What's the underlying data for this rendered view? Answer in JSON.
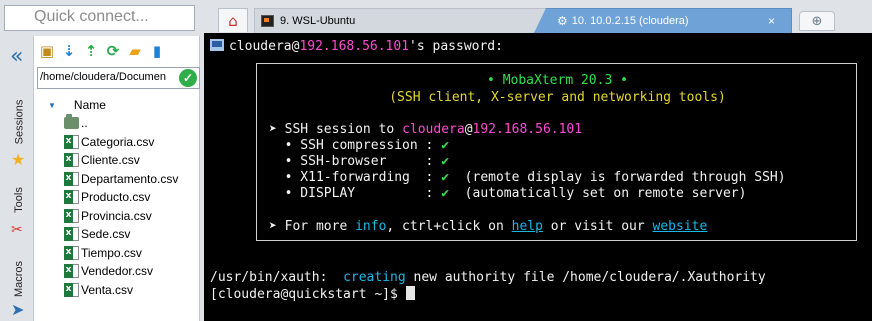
{
  "sidebar": {
    "quick_connect_placeholder": "Quick connect...",
    "collapse_glyph": "«",
    "vertical_tabs": [
      "Sessions",
      "Tools",
      "Macros"
    ],
    "path": "/home/cloudera/Documen",
    "file_header": "Name",
    "parent_dir": "..",
    "files": [
      "Categoria.csv",
      "Cliente.csv",
      "Departamento.csv",
      "Producto.csv",
      "Provincia.csv",
      "Sede.csv",
      "Tiempo.csv",
      "Vendedor.csv",
      "Venta.csv"
    ]
  },
  "tabs": {
    "tab1_label": "9. WSL-Ubuntu",
    "tab2_label": "10. 10.0.2.15 (cloudera)",
    "close_glyph": "×"
  },
  "terminal": {
    "pw_user": "cloudera",
    "pw_at": "@",
    "pw_host": "192.168.56.101",
    "pw_suffix": "'s password:",
    "banner_title": "• MobaXterm 20.3 •",
    "banner_sub": "(SSH client, X-server and networking tools)",
    "session_prefix": "➤ SSH session to ",
    "session_user": "cloudera",
    "session_at": "@",
    "session_host": "192.168.56.101",
    "features": [
      {
        "label": "  • SSH compression : ",
        "check": "✔",
        "note": ""
      },
      {
        "label": "  • SSH-browser     : ",
        "check": "✔",
        "note": ""
      },
      {
        "label": "  • X11-forwarding  : ",
        "check": "✔",
        "note": "  (remote display is forwarded through SSH)"
      },
      {
        "label": "  • DISPLAY         : ",
        "check": "✔",
        "note": "  (automatically set on remote server)"
      }
    ],
    "more_prefix": "➤ For more ",
    "more_info": "info",
    "more_mid": ", ctrl+click on ",
    "more_help": "help",
    "more_mid2": " or visit our ",
    "more_website": "website",
    "xauth_prefix": "/usr/bin/xauth:  ",
    "xauth_creating": "creating",
    "xauth_suffix": " new authority file /home/cloudera/.Xauthority",
    "prompt": "[cloudera@quickstart ~]$ "
  }
}
